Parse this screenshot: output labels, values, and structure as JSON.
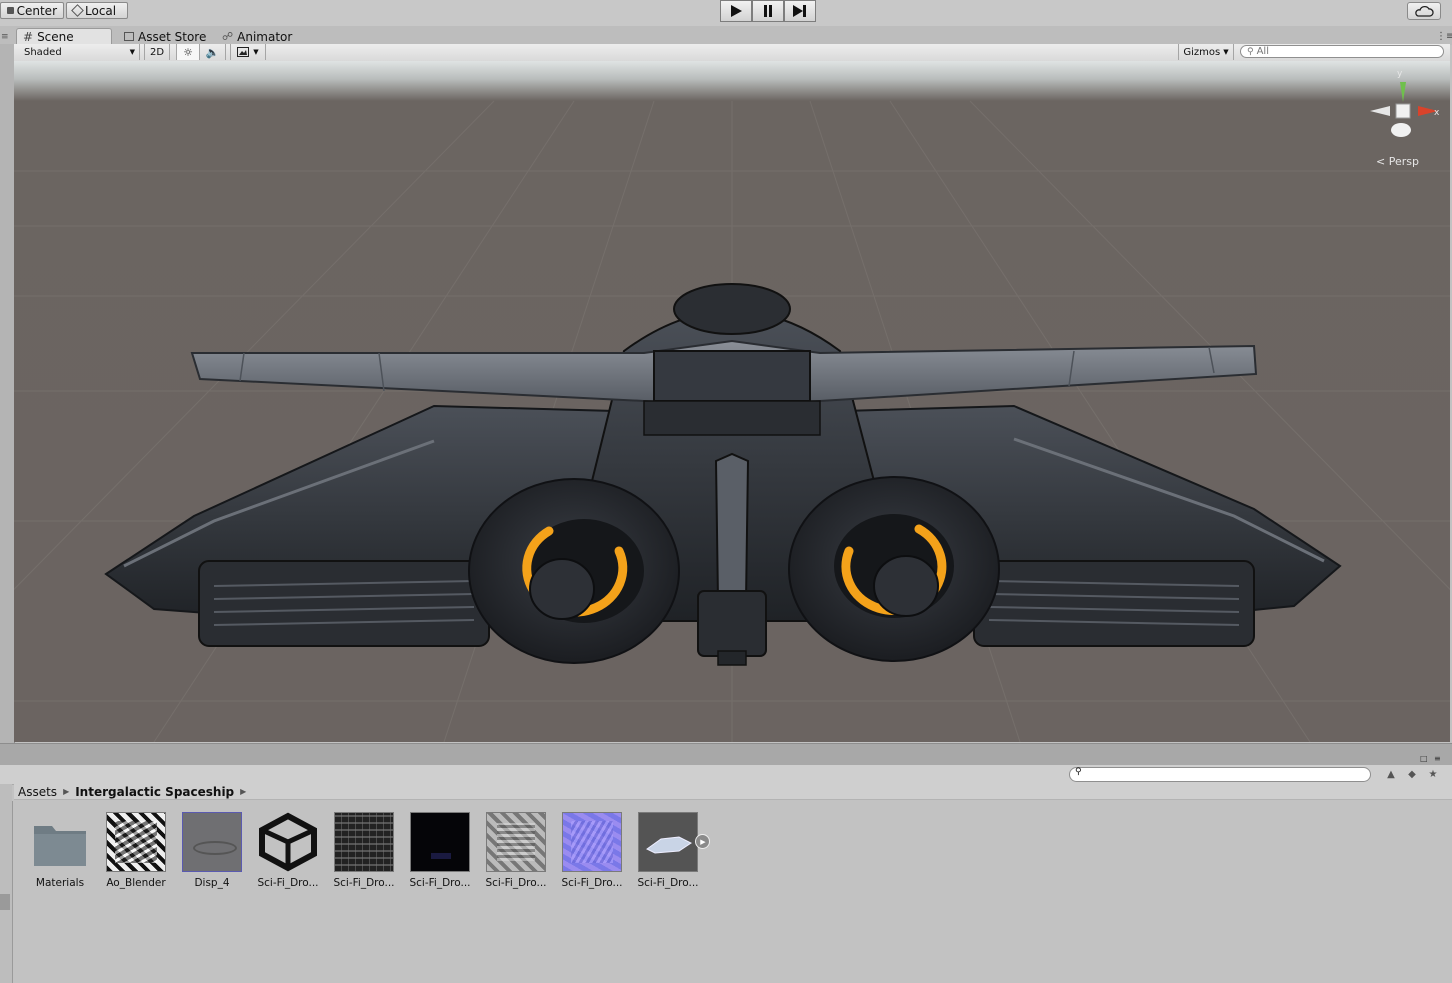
{
  "toolbar": {
    "center_label": "Center",
    "local_label": "Local"
  },
  "tabs": [
    {
      "label": "Scene",
      "active": true
    },
    {
      "label": "Asset Store",
      "active": false
    },
    {
      "label": "Animator",
      "active": false
    }
  ],
  "scene_toolbar": {
    "shading_mode": "Shaded",
    "mode_2d": "2D",
    "gizmos_label": "Gizmos",
    "search_placeholder": "All"
  },
  "viewport": {
    "axis_y": "y",
    "axis_x": "x",
    "projection_label": "Persp",
    "thruster_glow_color": "#f4a21a",
    "ground_color": "#6b6461"
  },
  "project": {
    "breadcrumb_root": "Assets",
    "breadcrumb_current": "Intergalactic Spaceship",
    "assets": [
      {
        "label": "Materials",
        "kind": "folder-icon"
      },
      {
        "label": "Ao_Blender",
        "kind": "texture-bw"
      },
      {
        "label": "Disp_4",
        "kind": "texture-gray"
      },
      {
        "label": "Sci-Fi_Dro...",
        "kind": "unity-logo-icon"
      },
      {
        "label": "Sci-Fi_Dro...",
        "kind": "texture-dark"
      },
      {
        "label": "Sci-Fi_Dro...",
        "kind": "texture-black"
      },
      {
        "label": "Sci-Fi_Dro...",
        "kind": "texture-light"
      },
      {
        "label": "Sci-Fi_Dro...",
        "kind": "texture-normal"
      },
      {
        "label": "Sci-Fi_Dro...",
        "kind": "mesh-preview"
      }
    ]
  }
}
